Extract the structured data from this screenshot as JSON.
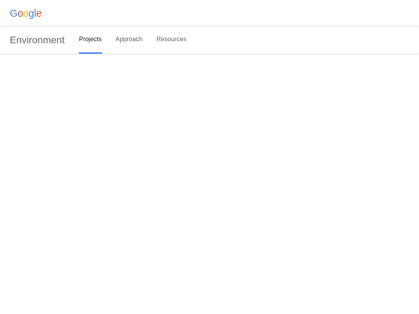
{
  "header": {
    "logo": {
      "letters": [
        {
          "char": "G",
          "color": "#4285F4"
        },
        {
          "char": "o",
          "color": "#EA4335"
        },
        {
          "char": "o",
          "color": "#FBBC05"
        },
        {
          "char": "g",
          "color": "#4285F4"
        },
        {
          "char": "l",
          "color": "#34A853"
        },
        {
          "char": "e",
          "color": "#EA4335"
        }
      ]
    }
  },
  "nav": {
    "site_title": "Environment",
    "tabs": [
      {
        "label": "Projects",
        "active": true
      },
      {
        "label": "Approach",
        "active": false
      },
      {
        "label": "Resources",
        "active": false
      }
    ],
    "active_indicator_color": "#4285F4"
  }
}
